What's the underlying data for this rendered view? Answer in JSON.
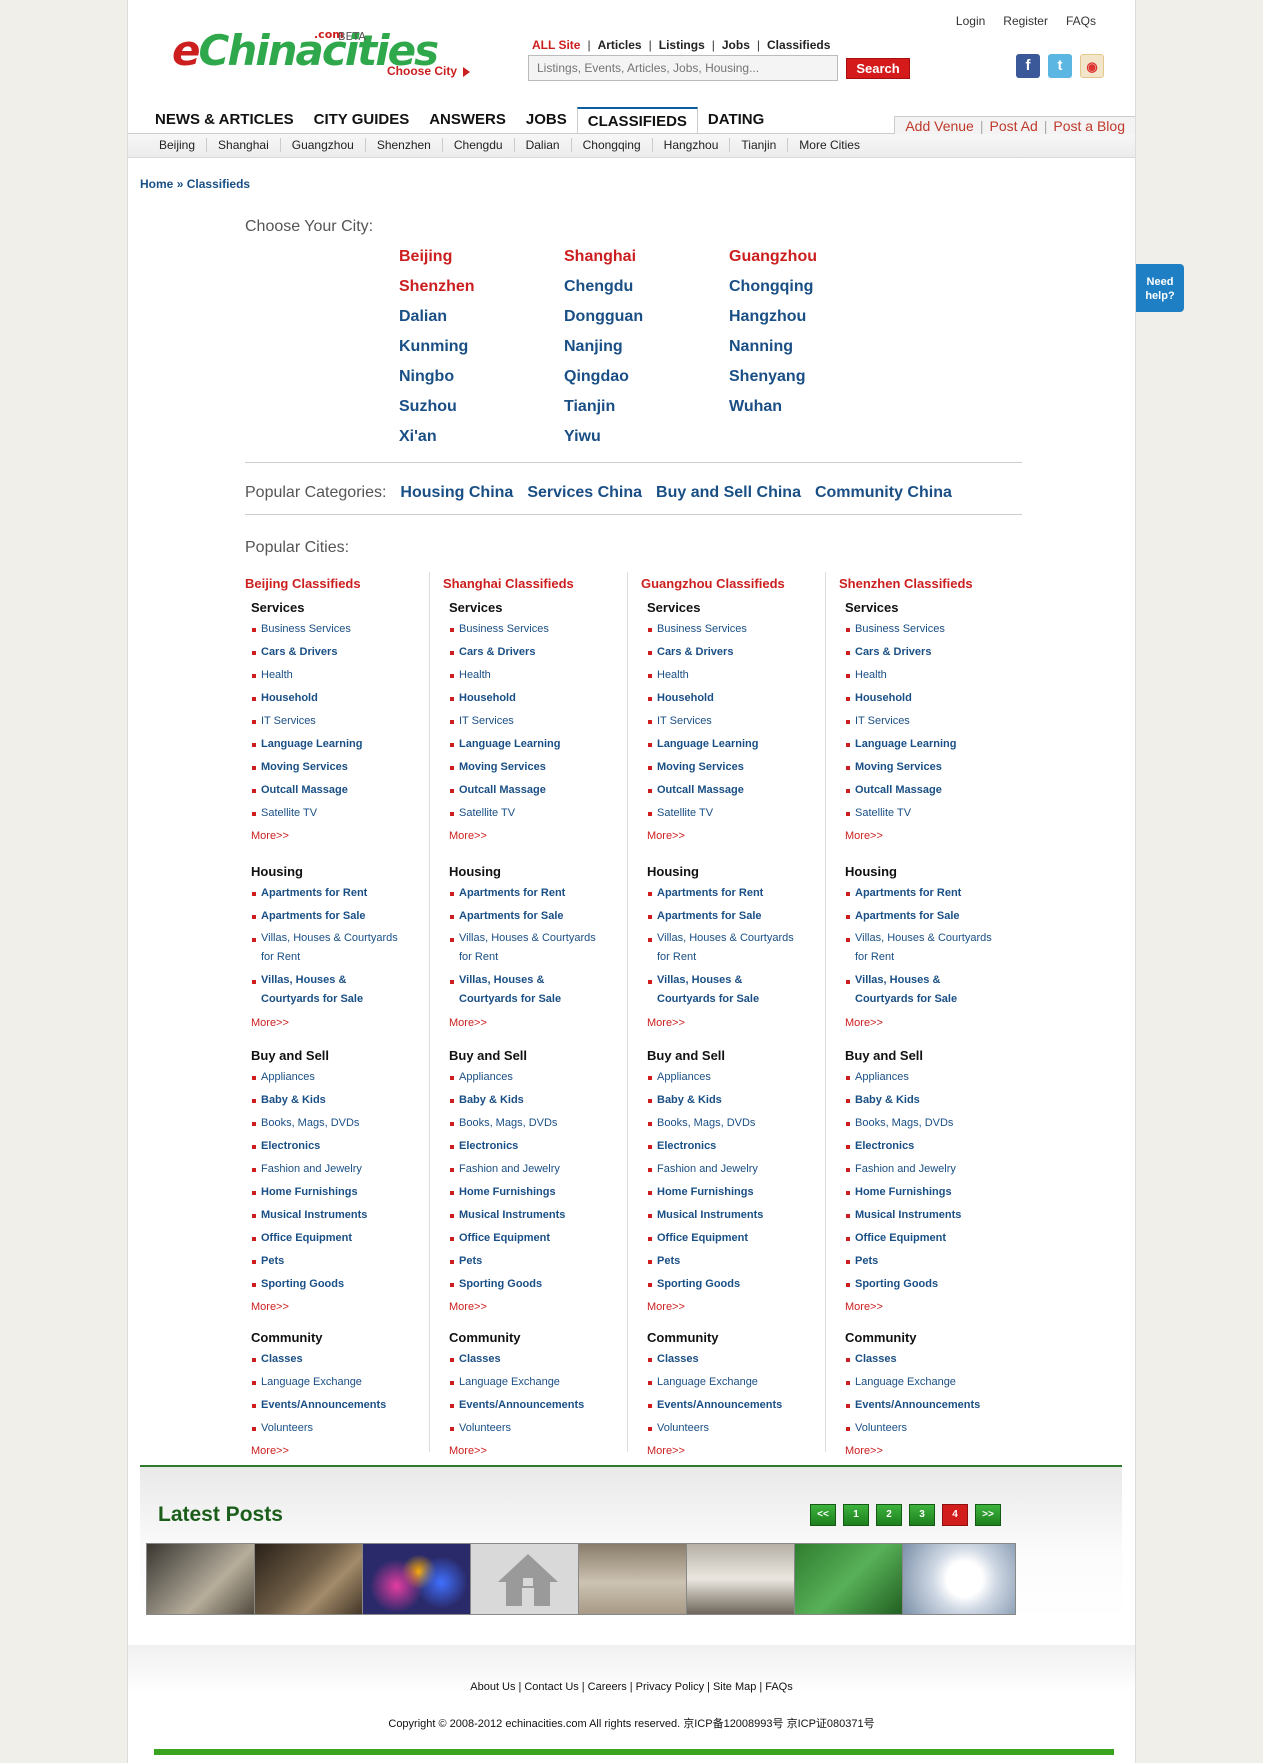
{
  "header": {
    "logo_e": "e",
    "logo_rest": "Chinacities",
    "logo_com": ".com",
    "logo_beta": "BETA",
    "choose_city": "Choose City",
    "top_links": [
      "Login",
      "Register",
      "FAQs"
    ],
    "site_nav": {
      "all": "ALL Site",
      "items": [
        "Articles",
        "Listings",
        "Jobs",
        "Classifieds"
      ]
    },
    "search_placeholder": "Listings, Events, Articles, Jobs, Housing...",
    "search_button": "Search",
    "social": [
      "facebook-icon",
      "twitter-icon",
      "weibo-icon"
    ]
  },
  "main_nav": [
    "NEWS & ARTICLES",
    "CITY GUIDES",
    "ANSWERS",
    "JOBS",
    "CLASSIFIEDS",
    "DATING"
  ],
  "main_nav_active": "CLASSIFIEDS",
  "right_tabs": [
    "Add Venue",
    "Post Ad",
    "Post a Blog"
  ],
  "city_bar": [
    "Beijing",
    "Shanghai",
    "Guangzhou",
    "Shenzhen",
    "Chengdu",
    "Dalian",
    "Chongqing",
    "Hangzhou",
    "Tianjin",
    "More Cities"
  ],
  "breadcrumb": {
    "home": "Home",
    "sep": "»",
    "current": "Classifieds"
  },
  "choose_city_heading": "Choose Your City:",
  "cities": [
    {
      "name": "Beijing",
      "hot": true
    },
    {
      "name": "Shanghai",
      "hot": true
    },
    {
      "name": "Guangzhou",
      "hot": true
    },
    {
      "name": "Shenzhen",
      "hot": true
    },
    {
      "name": "Chengdu",
      "hot": false
    },
    {
      "name": "Chongqing",
      "hot": false
    },
    {
      "name": "Dalian",
      "hot": false
    },
    {
      "name": "Dongguan",
      "hot": false
    },
    {
      "name": "Hangzhou",
      "hot": false
    },
    {
      "name": "Kunming",
      "hot": false
    },
    {
      "name": "Nanjing",
      "hot": false
    },
    {
      "name": "Nanning",
      "hot": false
    },
    {
      "name": "Ningbo",
      "hot": false
    },
    {
      "name": "Qingdao",
      "hot": false
    },
    {
      "name": "Shenyang",
      "hot": false
    },
    {
      "name": "Suzhou",
      "hot": false
    },
    {
      "name": "Tianjin",
      "hot": false
    },
    {
      "name": "Wuhan",
      "hot": false
    },
    {
      "name": "Xi'an",
      "hot": false
    },
    {
      "name": "Yiwu",
      "hot": false
    }
  ],
  "popular_categories": {
    "label": "Popular Categories:",
    "items": [
      "Housing China",
      "Services China",
      "Buy and Sell China",
      "Community China"
    ]
  },
  "popular_cities_heading": "Popular Cities:",
  "columns": [
    {
      "title": "Beijing Classifieds"
    },
    {
      "title": "Shanghai Classifieds"
    },
    {
      "title": "Guangzhou Classifieds"
    },
    {
      "title": "Shenzhen Classifieds"
    }
  ],
  "groups": [
    {
      "title": "Services",
      "items": [
        {
          "label": "Business Services",
          "bold": false
        },
        {
          "label": "Cars & Drivers",
          "bold": true
        },
        {
          "label": "Health",
          "bold": false
        },
        {
          "label": "Household",
          "bold": true
        },
        {
          "label": "IT Services",
          "bold": false
        },
        {
          "label": "Language Learning",
          "bold": true
        },
        {
          "label": "Moving Services",
          "bold": true
        },
        {
          "label": "Outcall Massage",
          "bold": true
        },
        {
          "label": "Satellite TV",
          "bold": false
        }
      ]
    },
    {
      "title": "Housing",
      "items": [
        {
          "label": "Apartments for Rent",
          "bold": true
        },
        {
          "label": "Apartments for Sale",
          "bold": true
        },
        {
          "label": "Villas, Houses & Courtyards for Rent",
          "bold": false,
          "two": true
        },
        {
          "label": "Villas, Houses & Courtyards for Sale",
          "bold": true,
          "two": true
        }
      ]
    },
    {
      "title": "Buy and Sell",
      "items": [
        {
          "label": "Appliances",
          "bold": false
        },
        {
          "label": "Baby & Kids",
          "bold": true
        },
        {
          "label": "Books, Mags, DVDs",
          "bold": false
        },
        {
          "label": "Electronics",
          "bold": true
        },
        {
          "label": "Fashion and Jewelry",
          "bold": false
        },
        {
          "label": "Home Furnishings",
          "bold": true
        },
        {
          "label": "Musical Instruments",
          "bold": true
        },
        {
          "label": "Office Equipment",
          "bold": true
        },
        {
          "label": "Pets",
          "bold": true
        },
        {
          "label": "Sporting Goods",
          "bold": true
        }
      ]
    },
    {
      "title": "Community",
      "items": [
        {
          "label": "Classes",
          "bold": true
        },
        {
          "label": "Language Exchange",
          "bold": false
        },
        {
          "label": "Events/Announcements",
          "bold": true
        },
        {
          "label": "Volunteers",
          "bold": false
        }
      ]
    }
  ],
  "more_label": "More>>",
  "latest_posts": {
    "title": "Latest Posts",
    "pager": [
      "<<",
      "1",
      "2",
      "3",
      "4",
      ">>"
    ],
    "active_page": "4",
    "thumbs": [
      "card-holder-photo",
      "furnished-room-photo",
      "colored-flasks-photo",
      "house-placeholder-icon",
      "living-room-photo",
      "bedroom-photo",
      "mahjong-table-photo",
      "white-kitten-photo"
    ]
  },
  "footer": {
    "links": [
      "About Us",
      "Contact Us",
      "Careers",
      "Privacy Policy",
      "Site Map",
      "FAQs"
    ],
    "copyright": "Copyright © 2008-2012 echinacities.com All rights reserved. 京ICP备12008993号 京ICP证080371号"
  },
  "need_help": [
    "Need",
    "help?"
  ],
  "colors": {
    "red": "#cc1e1e",
    "blue": "#1a4f85",
    "green": "#2ea84a"
  }
}
